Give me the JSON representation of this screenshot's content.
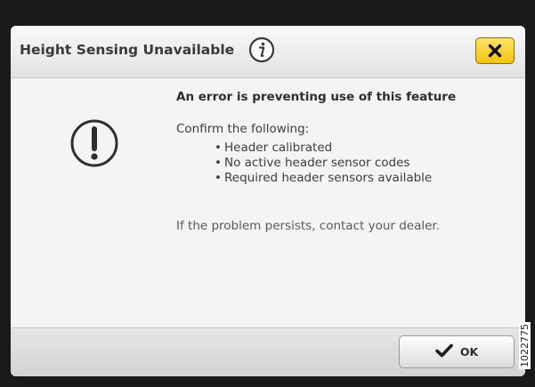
{
  "dialog": {
    "title": "Height Sensing Unavailable",
    "info_icon": "info-icon",
    "close_icon": "close-icon",
    "close_button_color": "#f5c518"
  },
  "message": {
    "warning_icon": "exclamation-circle-icon",
    "heading": "An error is preventing use of this feature",
    "confirm_intro": "Confirm the following:",
    "requirements": [
      "Header calibrated",
      "No active header sensor codes",
      "Required header sensors available"
    ],
    "persist_note": "If the problem persists, contact your dealer."
  },
  "footer": {
    "ok_icon": "checkmark-icon",
    "ok_label": "OK"
  },
  "figure_ref": "1022775"
}
